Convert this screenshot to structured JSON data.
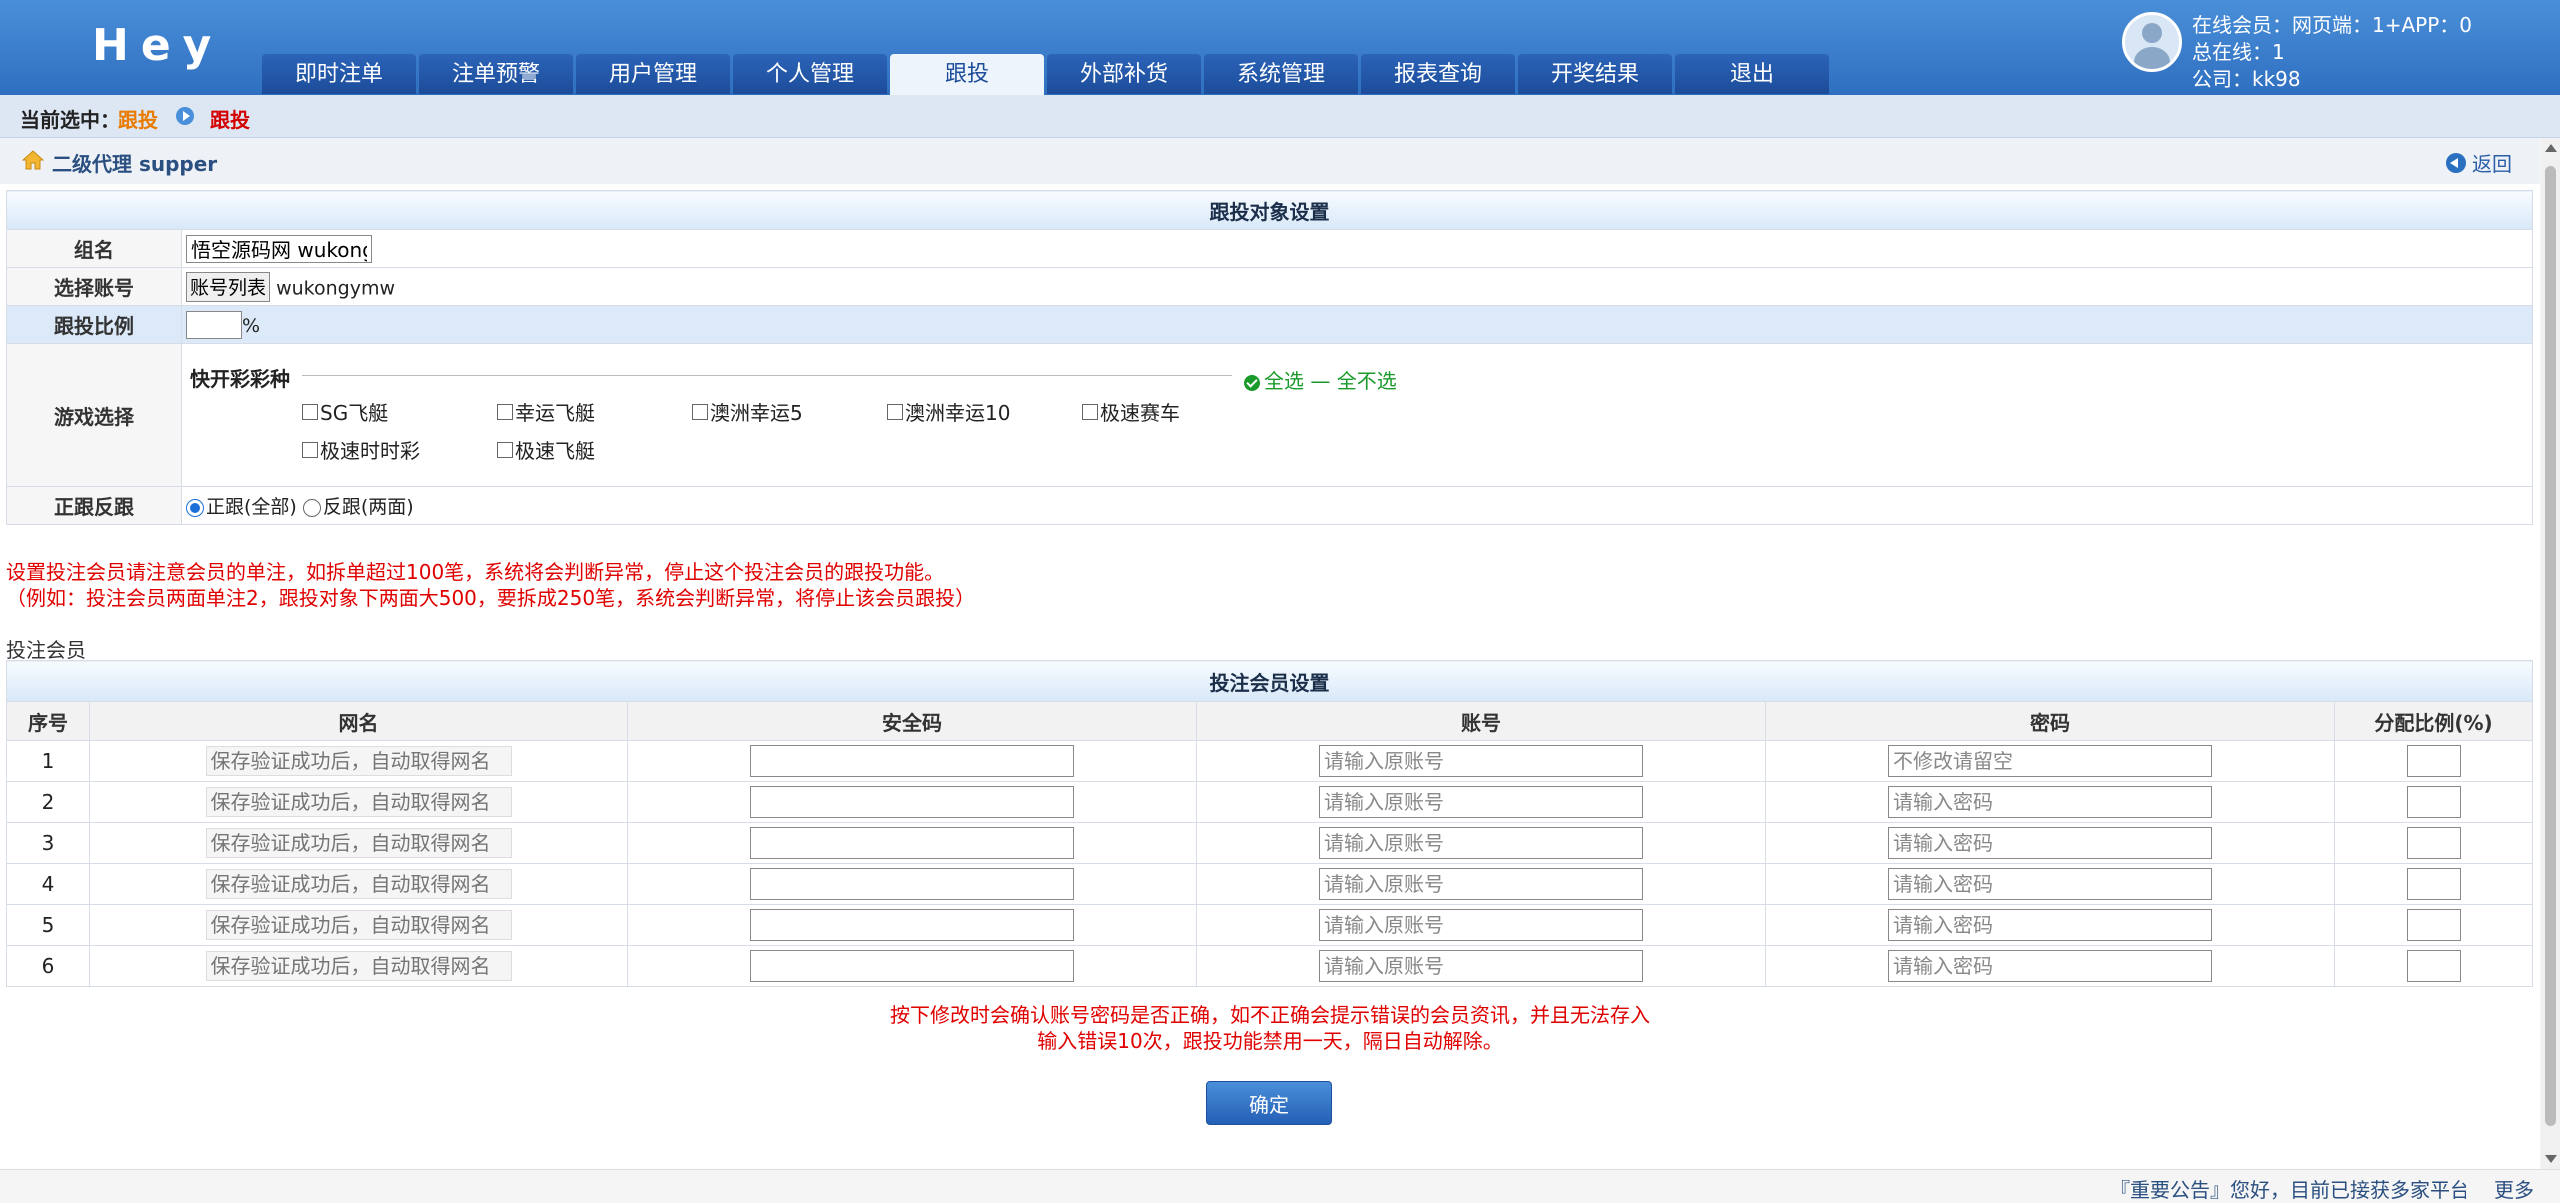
{
  "app": {
    "logo": "Hey"
  },
  "nav": {
    "tabs": [
      "即时注单",
      "注单预警",
      "用户管理",
      "个人管理",
      "跟投",
      "外部补货",
      "系统管理",
      "报表查询",
      "开奖结果",
      "退出"
    ],
    "active": "跟投"
  },
  "user": {
    "line1": "在线会员：网页端：1+APP：0",
    "line2": "总在线：1",
    "line3": "公司：kk98"
  },
  "crumb": {
    "label": "当前选中：",
    "item1": "跟投",
    "item2": "跟投"
  },
  "title": {
    "text": "二级代理 supper",
    "back": "返回"
  },
  "target": {
    "header": "跟投对象设置",
    "group_label": "组名",
    "group_value": "悟空源码网 wukong",
    "account_label": "选择账号",
    "account_button": "账号列表",
    "account_value": "wukongymw",
    "ratio_label": "跟投比例",
    "ratio_unit": "%",
    "game_label": "游戏选择",
    "game_section": "快开彩彩种",
    "select_all": "全选",
    "select_none": "全不选",
    "games": [
      "SG飞艇",
      "幸运飞艇",
      "澳洲幸运5",
      "澳洲幸运10",
      "极速赛车",
      "极速时时彩",
      "极速飞艇"
    ],
    "mode_label": "正跟反跟",
    "mode_forward": "正跟(全部)",
    "mode_reverse": "反跟(两面)"
  },
  "notes": {
    "line1": "设置投注会员请注意会员的单注，如拆单超过100笔，系统将会判断异常，停止这个投注会员的跟投功能。",
    "line2": "（例如：投注会员两面单注2，跟投对象下两面大500，要拆成250笔，系统会判断异常，将停止该会员跟投）"
  },
  "members": {
    "sub_label": "投注会员",
    "header": "投注会员设置",
    "columns": [
      "序号",
      "网名",
      "安全码",
      "账号",
      "密码",
      "分配比例(%)"
    ],
    "rows": [
      {
        "no": "1",
        "name_ph": "保存验证成功后，自动取得网名",
        "acct_ph": "请输入原账号",
        "pwd_ph": "不修改请留空"
      },
      {
        "no": "2",
        "name_ph": "保存验证成功后，自动取得网名",
        "acct_ph": "请输入原账号",
        "pwd_ph": "请输入密码"
      },
      {
        "no": "3",
        "name_ph": "保存验证成功后，自动取得网名",
        "acct_ph": "请输入原账号",
        "pwd_ph": "请输入密码"
      },
      {
        "no": "4",
        "name_ph": "保存验证成功后，自动取得网名",
        "acct_ph": "请输入原账号",
        "pwd_ph": "请输入密码"
      },
      {
        "no": "5",
        "name_ph": "保存验证成功后，自动取得网名",
        "acct_ph": "请输入原账号",
        "pwd_ph": "请输入密码"
      },
      {
        "no": "6",
        "name_ph": "保存验证成功后，自动取得网名",
        "acct_ph": "请输入原账号",
        "pwd_ph": "请输入密码"
      }
    ]
  },
  "warning": {
    "line1": "按下修改时会确认账号密码是否正确，如不正确会提示错误的会员资讯，并且无法存入",
    "line2": "输入错误10次，跟投功能禁用一天，隔日自动解除。"
  },
  "confirm": "确定",
  "footer": {
    "notice": "『重要公告』您好，目前已接获多家平台",
    "more": "更多"
  }
}
